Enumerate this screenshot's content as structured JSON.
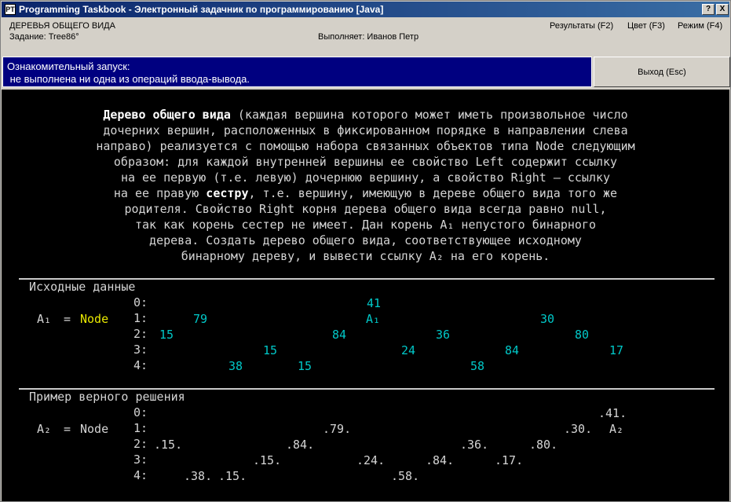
{
  "window": {
    "title": "Programming Taskbook - Электронный задачник по программированию [Java]",
    "help_label": "?",
    "close_label": "X"
  },
  "header": {
    "group": "ДЕРЕВЬЯ ОБЩЕГО ВИДА",
    "task": "Задание: Tree86°",
    "performer": "Выполняет: Иванов Петр",
    "menu": {
      "results": "Результаты (F2)",
      "color": "Цвет (F3)",
      "mode": "Режим (F4)"
    }
  },
  "status": {
    "line1": "Ознакомительный запуск:",
    "line2": " не выполнена ни одна из операций ввода-вывода."
  },
  "exit_label": "Выход (Esc)",
  "description": {
    "lines": [
      [
        {
          "b": "Дерево общего вида"
        },
        {
          "t": " (каждая вершина которого может иметь произвольное число"
        }
      ],
      [
        {
          "t": "дочерних вершин, расположенных в фиксированном порядке в направлении слева"
        }
      ],
      [
        {
          "t": "направо) реализуется с помощью набора связанных объектов типа Node следующим"
        }
      ],
      [
        {
          "t": "образом: для каждой внутренней вершины ее свойство Left содержит ссылку"
        }
      ],
      [
        {
          "t": "на ее первую (т.е. левую) дочернюю вершину, а свойство Right — ссылку"
        }
      ],
      [
        {
          "t": "на ее правую "
        },
        {
          "b": "сестру"
        },
        {
          "t": ", т.е. вершину, имеющую в дереве общего вида того же"
        }
      ],
      [
        {
          "t": "родителя. Свойство Right корня дерева общего вида всегда равно null,"
        }
      ],
      [
        {
          "t": "так как корень сестер не имеет. Дан корень A₁ непустого бинарного"
        }
      ],
      [
        {
          "t": "дерева. Создать дерево общего вида, соответствующее исходному"
        }
      ],
      [
        {
          "t": "бинарному дереву, и вывести ссылку A₂ на его корень."
        }
      ]
    ]
  },
  "input_section": {
    "title": "Исходные данные",
    "var": "A₁",
    "eq": "=",
    "type": "Node",
    "levels": [
      "0:",
      "1:",
      "2:",
      "3:",
      "4:"
    ],
    "nodes": [
      "41",
      "A₁",
      "79",
      "30",
      "15",
      "84",
      "36",
      "80",
      "15",
      "24",
      "84",
      "17",
      "38",
      "15",
      "58"
    ]
  },
  "output_section": {
    "title": "Пример верного решения",
    "var": "A₂",
    "eq": "=",
    "type": "Node",
    "levels": [
      "0:",
      "1:",
      "2:",
      "3:",
      "4:"
    ],
    "nodes": [
      ".41.",
      ".79.",
      ".30.",
      "A₂",
      ".15.",
      ".84.",
      ".36.",
      ".80.",
      ".15.",
      ".24.",
      ".84.",
      ".17.",
      ".38.",
      ".15.",
      ".58."
    ]
  },
  "colors": {
    "console_bg": "#000000",
    "text": "#d4d4d4",
    "tree": "#00c8c8",
    "node_type": "#e8e800",
    "title_bar": "#0a246a",
    "status_bg": "#000080"
  }
}
